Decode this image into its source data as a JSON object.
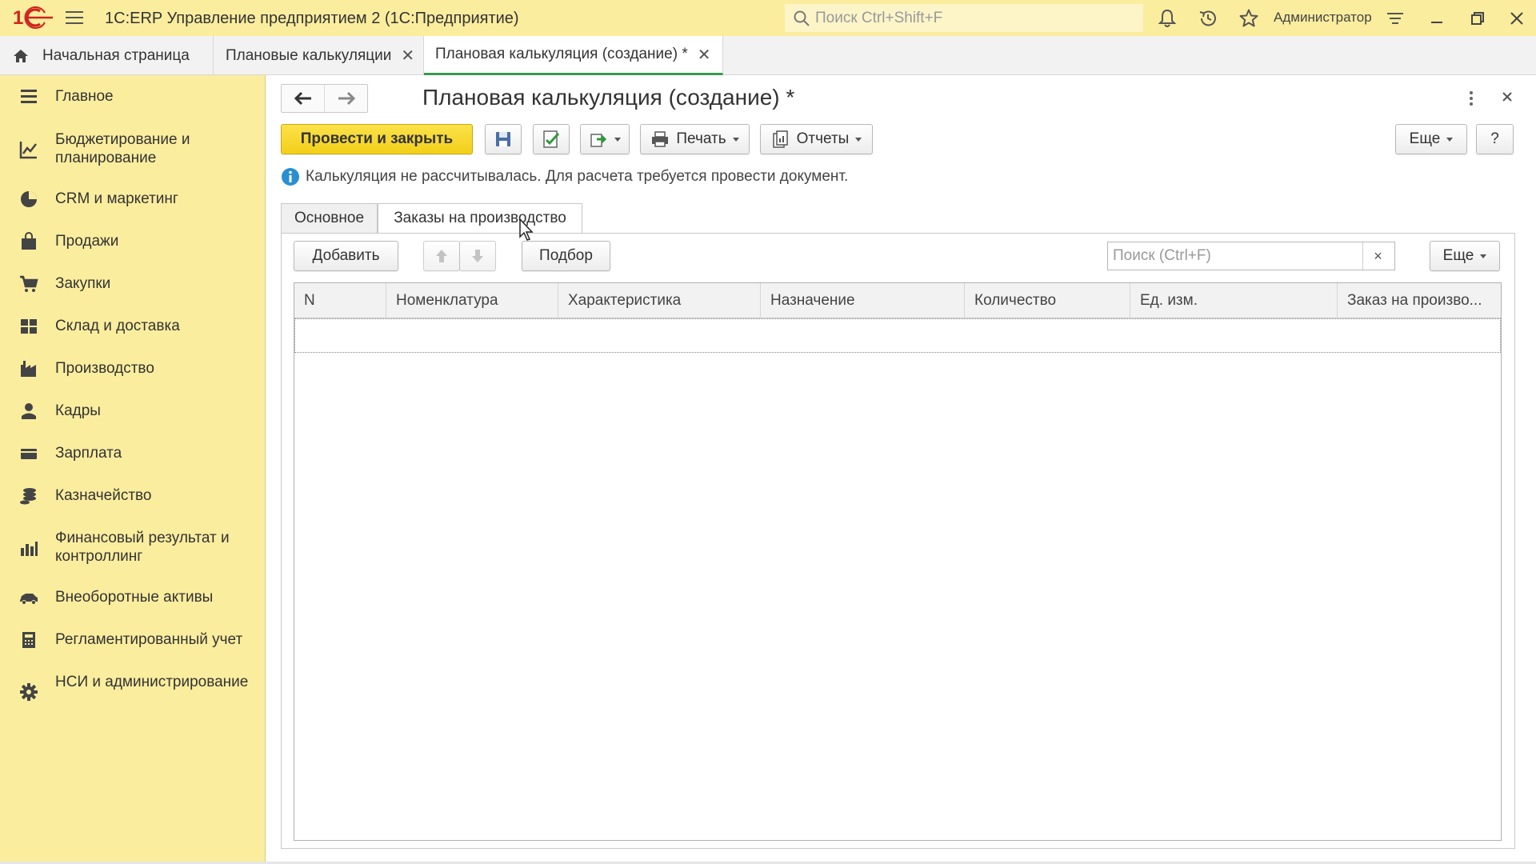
{
  "app": {
    "title": "1С:ERP Управление предприятием 2  (1С:Предприятие)",
    "search_placeholder": "Поиск Ctrl+Shift+F",
    "user": "Администратор"
  },
  "section_tabs": [
    {
      "label": "Начальная страница"
    },
    {
      "label": "Плановые калькуляции"
    },
    {
      "label": "Плановая калькуляция (создание) *"
    }
  ],
  "sidebar": {
    "items": [
      {
        "label": "Главное",
        "icon": "menu-lines-icon"
      },
      {
        "label": "Бюджетирование и планирование",
        "icon": "budget-chart-icon"
      },
      {
        "label": "CRM и маркетинг",
        "icon": "pie-chart-icon"
      },
      {
        "label": "Продажи",
        "icon": "shopping-bag-icon"
      },
      {
        "label": "Закупки",
        "icon": "cart-icon"
      },
      {
        "label": "Склад и доставка",
        "icon": "warehouse-grid-icon"
      },
      {
        "label": "Производство",
        "icon": "factory-icon"
      },
      {
        "label": "Кадры",
        "icon": "person-icon"
      },
      {
        "label": "Зарплата",
        "icon": "wallet-icon"
      },
      {
        "label": "Казначейство",
        "icon": "coins-icon"
      },
      {
        "label": "Финансовый результат и контроллинг",
        "icon": "bar-chart-icon"
      },
      {
        "label": "Внеоборотные активы",
        "icon": "assets-car-icon"
      },
      {
        "label": "Регламентированный учет",
        "icon": "calculator-icon"
      },
      {
        "label": "НСИ и администрирование",
        "icon": "gear-icon"
      }
    ]
  },
  "form": {
    "title": "Плановая калькуляция (создание) *",
    "toolbar": {
      "post_and_close": "Провести и закрыть",
      "print": "Печать",
      "reports": "Отчеты",
      "more": "Еще",
      "help": "?"
    },
    "info_message": "Калькуляция не рассчитывалась. Для расчета требуется провести документ.",
    "tabs": [
      {
        "label": "Основное",
        "active": false
      },
      {
        "label": "Заказы на производство",
        "active": true
      }
    ],
    "table_toolbar": {
      "add": "Добавить",
      "pick": "Подбор",
      "search_placeholder": "Поиск (Ctrl+F)",
      "clear": "×",
      "more": "Еще"
    },
    "table": {
      "columns": [
        "N",
        "Номенклатура",
        "Характеристика",
        "Назначение",
        "Количество",
        "Ед. изм.",
        "Заказ на произво..."
      ],
      "rows": []
    }
  },
  "colors": {
    "accent_yellow": "#fbed9e",
    "primary_button": "#f3cf1a",
    "active_tab_underline": "#3a9a4a",
    "info_icon": "#2a8fd0"
  }
}
